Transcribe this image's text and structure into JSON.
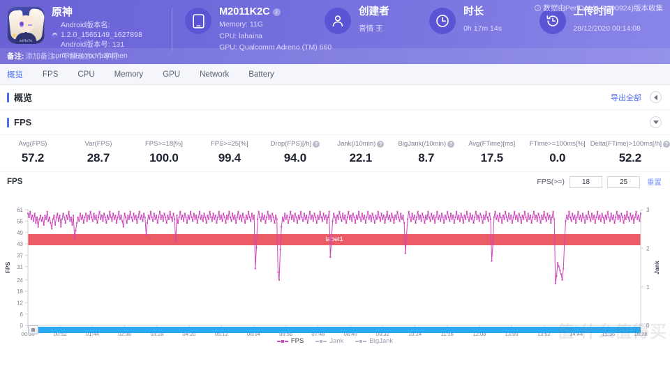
{
  "header": {
    "collect_note": "数据由PerfDog(4.3.200924)版本收集",
    "app": {
      "title": "原神",
      "version_name_label": "Android版本名:",
      "version_name": "1.2.0_1565149_1627898",
      "version_code": "Android版本号: 131",
      "package": "com.miHoYo.Yuanshen"
    },
    "device": {
      "name": "M2011K2C",
      "memory": "Memory: 11G",
      "cpu": "CPU: lahaina",
      "gpu": "GPU: Qualcomm Adreno (TM) 660"
    },
    "creator": {
      "title": "创建者",
      "value": "喜情 王"
    },
    "duration": {
      "title": "时长",
      "value": "0h 17m 14s"
    },
    "upload": {
      "title": "上传时间",
      "value": "28/12/2020 00:14:08"
    },
    "remark": {
      "label": "备注:",
      "placeholder": "添加备注，不超过200个字符"
    }
  },
  "tabs": [
    {
      "label": "概览",
      "active": true
    },
    {
      "label": "FPS",
      "active": false
    },
    {
      "label": "CPU",
      "active": false
    },
    {
      "label": "Memory",
      "active": false
    },
    {
      "label": "GPU",
      "active": false
    },
    {
      "label": "Network",
      "active": false
    },
    {
      "label": "Battery",
      "active": false
    }
  ],
  "overview": {
    "title": "概览",
    "export_label": "导出全部"
  },
  "fps_section": {
    "title": "FPS",
    "metrics": [
      {
        "label": "Avg(FPS)",
        "value": "57.2",
        "help": false
      },
      {
        "label": "Var(FPS)",
        "value": "28.7",
        "help": false
      },
      {
        "label": "FPS>=18[%]",
        "value": "100.0",
        "help": false
      },
      {
        "label": "FPS>=25[%]",
        "value": "99.4",
        "help": false
      },
      {
        "label": "Drop(FPS)[/h]",
        "value": "94.0",
        "help": true
      },
      {
        "label": "Jank(/10min)",
        "value": "22.1",
        "help": true
      },
      {
        "label": "BigJank(/10min)",
        "value": "8.7",
        "help": true
      },
      {
        "label": "Avg(FTime)[ms]",
        "value": "17.5",
        "help": false
      },
      {
        "label": "FTime>=100ms[%]",
        "value": "0.0",
        "help": false
      },
      {
        "label": "Delta(FTime)>100ms[/h]",
        "value": "52.2",
        "help": true
      }
    ],
    "chart_title": "FPS",
    "threshold_label": "FPS(>=)",
    "threshold_low": "18",
    "threshold_high": "25",
    "reset_label": "重置",
    "band_label": "label1"
  },
  "colors": {
    "brand_purple": "#6b62d6",
    "accent_blue": "#4f6ef7",
    "fps_line": "#cc46bb",
    "band_red": "#ec5c66",
    "slider_blue": "#29aaf2",
    "jank_grey": "#9aa0ad"
  },
  "watermark": "值 什么值得买",
  "chart_data": {
    "type": "line",
    "title": "FPS",
    "xlabel": "",
    "ylabel": "FPS",
    "y2label": "Jank",
    "grid": false,
    "legend": [
      {
        "name": "FPS",
        "color": "#cc46bb",
        "active": true
      },
      {
        "name": "Jank",
        "color": "#9aa0ad",
        "active": false
      },
      {
        "name": "BigJank",
        "color": "#9aa0ad",
        "active": false
      }
    ],
    "yticks": [
      0,
      6,
      12,
      18,
      24,
      31,
      37,
      43,
      49,
      55,
      61
    ],
    "ylim": [
      0,
      61
    ],
    "y2ticks": [
      0,
      1,
      2,
      3
    ],
    "y2lim": [
      0,
      3
    ],
    "xticks": [
      "00:00",
      "00:52",
      "01:44",
      "02:36",
      "03:28",
      "04:20",
      "05:12",
      "06:04",
      "06:56",
      "07:48",
      "08:40",
      "09:32",
      "10:24",
      "11:16",
      "12:08",
      "13:00",
      "13:52",
      "14:44",
      "15:36",
      "16:28"
    ],
    "series": [
      {
        "name": "FPS",
        "color": "#cc46bb",
        "values": [
          59,
          57,
          60,
          56,
          58,
          55,
          59,
          54,
          57,
          52,
          56,
          58,
          55,
          57,
          53,
          58,
          56,
          60,
          55,
          57,
          54,
          51,
          56,
          58,
          53,
          57,
          59,
          55,
          58,
          52,
          56,
          59,
          57,
          54,
          58,
          56,
          60,
          55,
          57,
          53,
          58,
          46,
          50,
          54,
          57,
          55,
          59,
          56,
          58,
          54,
          57,
          59,
          55,
          58,
          56,
          60,
          57,
          55,
          59,
          56,
          58,
          54,
          57,
          60,
          56,
          58,
          55,
          59,
          57,
          54,
          58,
          56,
          60,
          57,
          55,
          59,
          56,
          58,
          54,
          57,
          60,
          56,
          58,
          55,
          52,
          59,
          57,
          54,
          58,
          56,
          60,
          57,
          55,
          59,
          56,
          58,
          54,
          57,
          60,
          56,
          58,
          55,
          59,
          57,
          48,
          54,
          58,
          56,
          60,
          57,
          55,
          59,
          56,
          58,
          54,
          57,
          60,
          56,
          58,
          55,
          59,
          57,
          54,
          58,
          56,
          60,
          57,
          55,
          59,
          56,
          44,
          58,
          54,
          57,
          60,
          56,
          58,
          55,
          59,
          57,
          54,
          58,
          56,
          60,
          57,
          55,
          59,
          56,
          58,
          54,
          57,
          60,
          56,
          58,
          55,
          59,
          57,
          54,
          58,
          56,
          60,
          57,
          55,
          59,
          56,
          58,
          54,
          57,
          60,
          56,
          58,
          55,
          59,
          57,
          54,
          58,
          56,
          60,
          57,
          55,
          59,
          56,
          58,
          54,
          57,
          60,
          56,
          58,
          55,
          59,
          57,
          54,
          58,
          56,
          60,
          57,
          55,
          59,
          56,
          58,
          30,
          41,
          56,
          60,
          57,
          55,
          59,
          56,
          58,
          54,
          57,
          60,
          56,
          58,
          55,
          59,
          57,
          54,
          58,
          56,
          28,
          24,
          40,
          52,
          57,
          55,
          59,
          56,
          58,
          54,
          57,
          60,
          56,
          58,
          55,
          59,
          57,
          54,
          58,
          56,
          60,
          57,
          55,
          59,
          56,
          58,
          54,
          57,
          60,
          56,
          58,
          55,
          59,
          57,
          54,
          58,
          56,
          60,
          57,
          55,
          59,
          56,
          58,
          54,
          57,
          60,
          36,
          45,
          55,
          59,
          57,
          54,
          58,
          56,
          60,
          57,
          55,
          59,
          56,
          58,
          54,
          57,
          60,
          56,
          58,
          55,
          59,
          57,
          54,
          58,
          56,
          60,
          57,
          55,
          59,
          56,
          58,
          54,
          57,
          60,
          56,
          58,
          55,
          59,
          57,
          54,
          58,
          56,
          60,
          57,
          55,
          59,
          56,
          58,
          54,
          57,
          60,
          56,
          58,
          55,
          59,
          57,
          54,
          58,
          56,
          60,
          57,
          55,
          59,
          56,
          58,
          54,
          38,
          47,
          56,
          60,
          57,
          55,
          59,
          56,
          58,
          54,
          57,
          60,
          56,
          58,
          55,
          59,
          57,
          54,
          58,
          56,
          60,
          57,
          55,
          59,
          56,
          58,
          54,
          57,
          60,
          56,
          58,
          55,
          59,
          57,
          54,
          58,
          56,
          60,
          57,
          55,
          59,
          56,
          58,
          54,
          57,
          60,
          56,
          58,
          55,
          59,
          57,
          54,
          58,
          56,
          60,
          57,
          55,
          59,
          56,
          58,
          54,
          57,
          60,
          56,
          58,
          55,
          59,
          57,
          54,
          58,
          56,
          60,
          57,
          55,
          59,
          56,
          34,
          43,
          57,
          60,
          56,
          58,
          55,
          59,
          57,
          54,
          58,
          56,
          60,
          57,
          55,
          59,
          56,
          58,
          54,
          57,
          60,
          56,
          58,
          55,
          59,
          57,
          54,
          58,
          56,
          60,
          57,
          55,
          59,
          56,
          58,
          54,
          57,
          60,
          56,
          58,
          55,
          59,
          57,
          54,
          58,
          56,
          60,
          57,
          55,
          59,
          56,
          58,
          54,
          57,
          60,
          56,
          22,
          26,
          33,
          31,
          29,
          27,
          24,
          30,
          44,
          55,
          58,
          56,
          60,
          57,
          55,
          59,
          56,
          58,
          54,
          57,
          60,
          56,
          58,
          55,
          59,
          57,
          54,
          58,
          56,
          60,
          57,
          55,
          59,
          56,
          58,
          54,
          57,
          60,
          56,
          58,
          55,
          59,
          57,
          54,
          58,
          56,
          60,
          57,
          55,
          59,
          56,
          58,
          54,
          57,
          60,
          56,
          58,
          55,
          59,
          57,
          54,
          58,
          56,
          60,
          57,
          55,
          59,
          56,
          58,
          54,
          57,
          60,
          56,
          58,
          55,
          59
        ]
      }
    ]
  }
}
